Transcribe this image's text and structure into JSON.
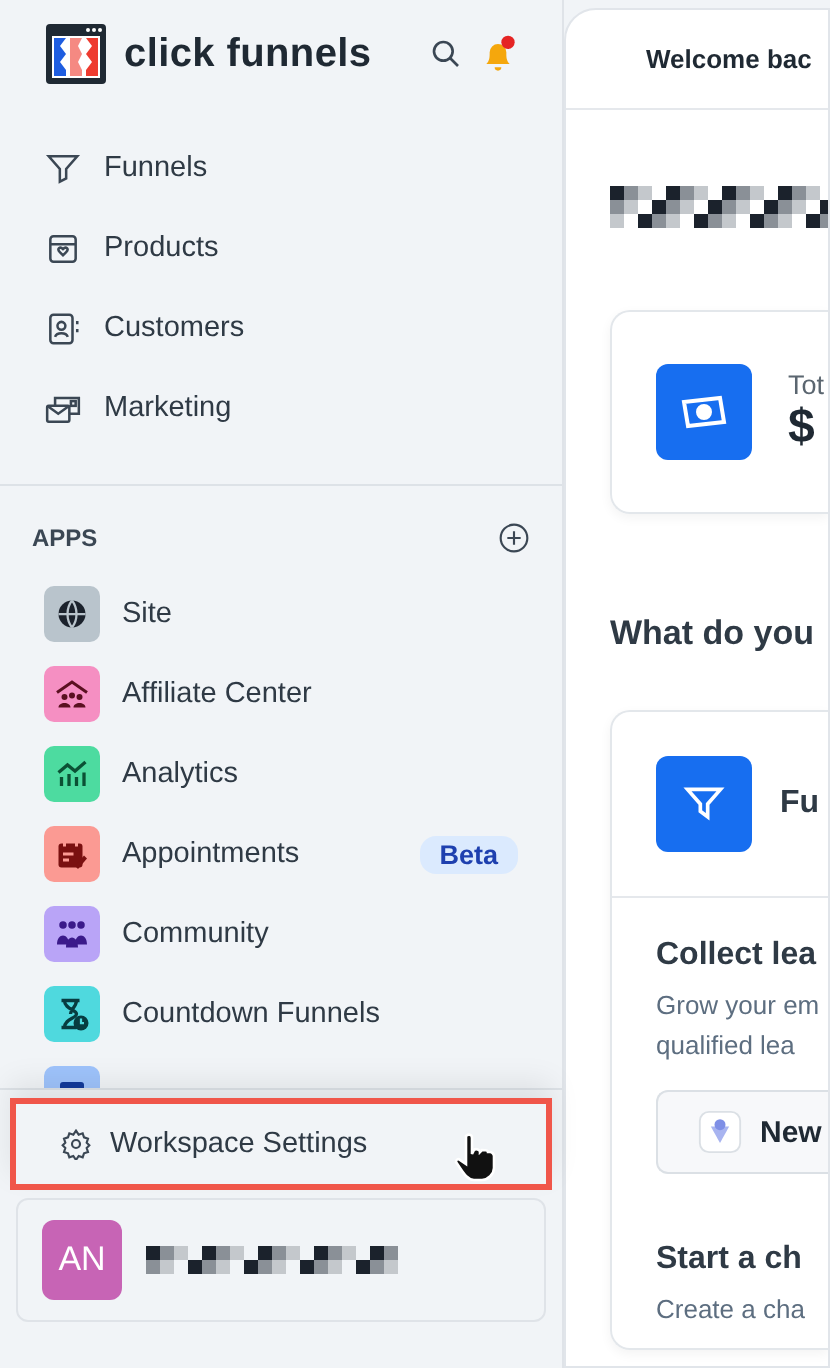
{
  "brand": {
    "name": "click funnels",
    "notification": true
  },
  "nav": [
    {
      "label": "Funnels"
    },
    {
      "label": "Products"
    },
    {
      "label": "Customers"
    },
    {
      "label": "Marketing"
    }
  ],
  "apps": {
    "heading": "APPS",
    "items": [
      {
        "label": "Site",
        "color": "#b9c4cc"
      },
      {
        "label": "Affiliate Center",
        "color": "#f58fc2"
      },
      {
        "label": "Analytics",
        "color": "#4ddba0"
      },
      {
        "label": "Appointments",
        "color": "#fb9a93",
        "badge": "Beta"
      },
      {
        "label": "Community",
        "color": "#b9a4f7"
      },
      {
        "label": "Countdown Funnels",
        "color": "#4fd9de"
      },
      {
        "color": "#9ec3fb"
      }
    ]
  },
  "menu": {
    "label": "Workspace Settings",
    "highlighted": true
  },
  "account": {
    "initials": "AN"
  },
  "main": {
    "header": "Welcome bac",
    "stat": {
      "label": "Tot",
      "value": "$"
    },
    "question": "What do you",
    "card": {
      "title": "Fu",
      "sections": [
        {
          "title": "Collect lea",
          "text": "Grow your em",
          "text2": "qualified lea",
          "button": "New"
        },
        {
          "title": "Start a ch",
          "text": "Create a cha"
        }
      ]
    }
  }
}
